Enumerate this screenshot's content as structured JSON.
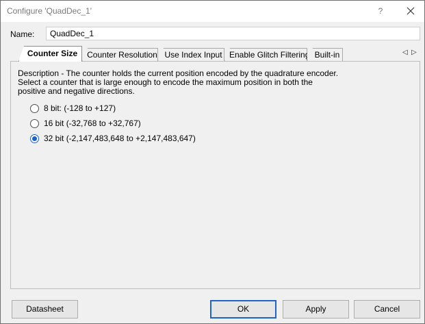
{
  "window": {
    "title": "Configure 'QuadDec_1'",
    "help_glyph": "?",
    "close_icon": "close-icon"
  },
  "name_row": {
    "label": "Name:",
    "value": "QuadDec_1"
  },
  "tabs": [
    {
      "label": "Counter Size",
      "active": true
    },
    {
      "label": "Counter Resolution",
      "active": false
    },
    {
      "label": "Use Index Input",
      "active": false
    },
    {
      "label": "Enable Glitch Filtering",
      "active": false
    },
    {
      "label": "Built-in",
      "active": false
    }
  ],
  "tab_scroll": {
    "left": "◁",
    "right": "▷"
  },
  "panel": {
    "description": "Description - The counter holds the current position encoded by the quadrature encoder. Select a counter that is large enough to encode the maximum position in both the positive and negative directions.",
    "options": [
      {
        "label": "8 bit: (-128 to +127)",
        "selected": false
      },
      {
        "label": "16 bit (-32,768 to +32,767)",
        "selected": false
      },
      {
        "label": "32 bit (-2,147,483,648 to +2,147,483,647)",
        "selected": true
      }
    ]
  },
  "buttons": {
    "datasheet": "Datasheet",
    "ok": "OK",
    "apply": "Apply",
    "cancel": "Cancel"
  },
  "colors": {
    "accent": "#1e64c8",
    "dialog_bg": "#f0f0f0"
  }
}
